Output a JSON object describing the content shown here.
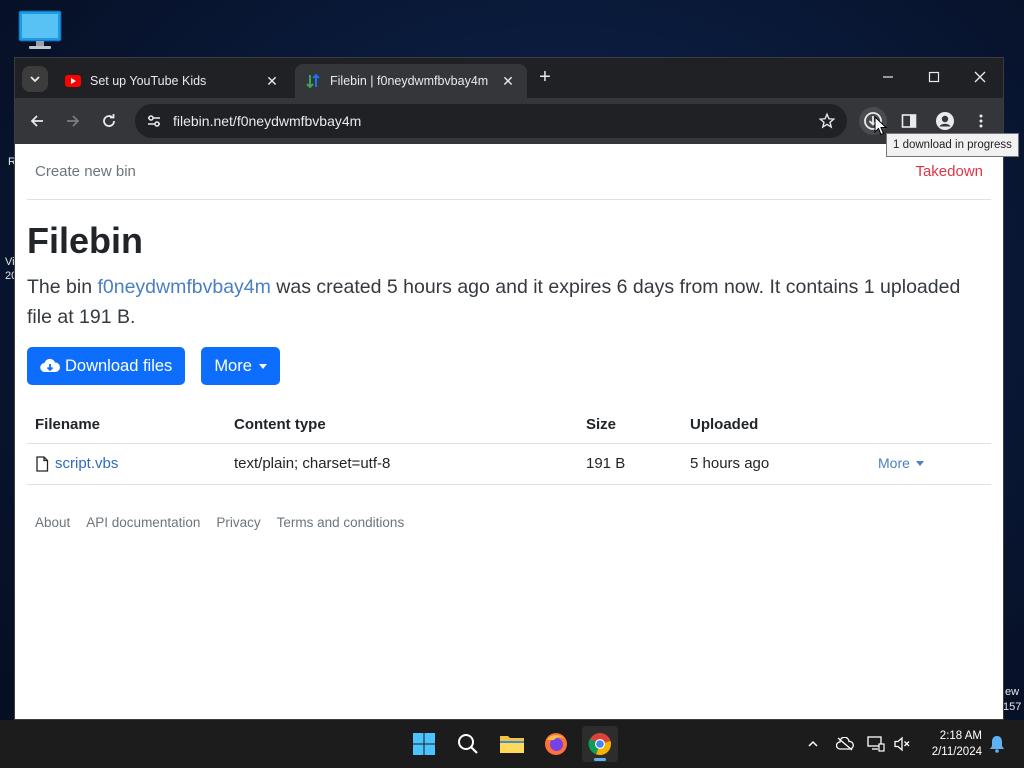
{
  "desktop": {
    "edge_text_left_1": "R",
    "edge_text_left_2": "Vi",
    "edge_text_left_3": "20",
    "edge_text_right_1": "ew",
    "edge_text_right_2": "157"
  },
  "browser": {
    "tabs": [
      {
        "title": "Set up YouTube Kids",
        "active": false,
        "icon": "youtube-icon"
      },
      {
        "title": "Filebin | f0neydwmfbvbay4m",
        "active": true,
        "icon": "filebin-icon"
      }
    ],
    "url": "filebin.net/f0neydwmfbvbay4m",
    "tooltip": "1 download in progress"
  },
  "page": {
    "nav": {
      "create_new_bin": "Create new bin",
      "takedown": "Takedown"
    },
    "heading": "Filebin",
    "lead": {
      "prefix": "The bin ",
      "bin_id": "f0neydwmfbvbay4m",
      "suffix": " was created 5 hours ago and it expires 6 days from now. It contains 1 uploaded file at 191 B."
    },
    "buttons": {
      "download": "Download files",
      "more": "More"
    },
    "table": {
      "headers": [
        "Filename",
        "Content type",
        "Size",
        "Uploaded"
      ],
      "rows": [
        {
          "filename": "script.vbs",
          "content_type": "text/plain; charset=utf-8",
          "size": "191 B",
          "uploaded": "5 hours ago",
          "action": "More"
        }
      ]
    },
    "footer": [
      "About",
      "API documentation",
      "Privacy",
      "Terms and conditions"
    ]
  },
  "taskbar": {
    "time": "2:18 AM",
    "date": "2/11/2024"
  },
  "colors": {
    "primary": "#0d6efd",
    "danger": "#dc3545",
    "link": "#4a7fc0"
  }
}
